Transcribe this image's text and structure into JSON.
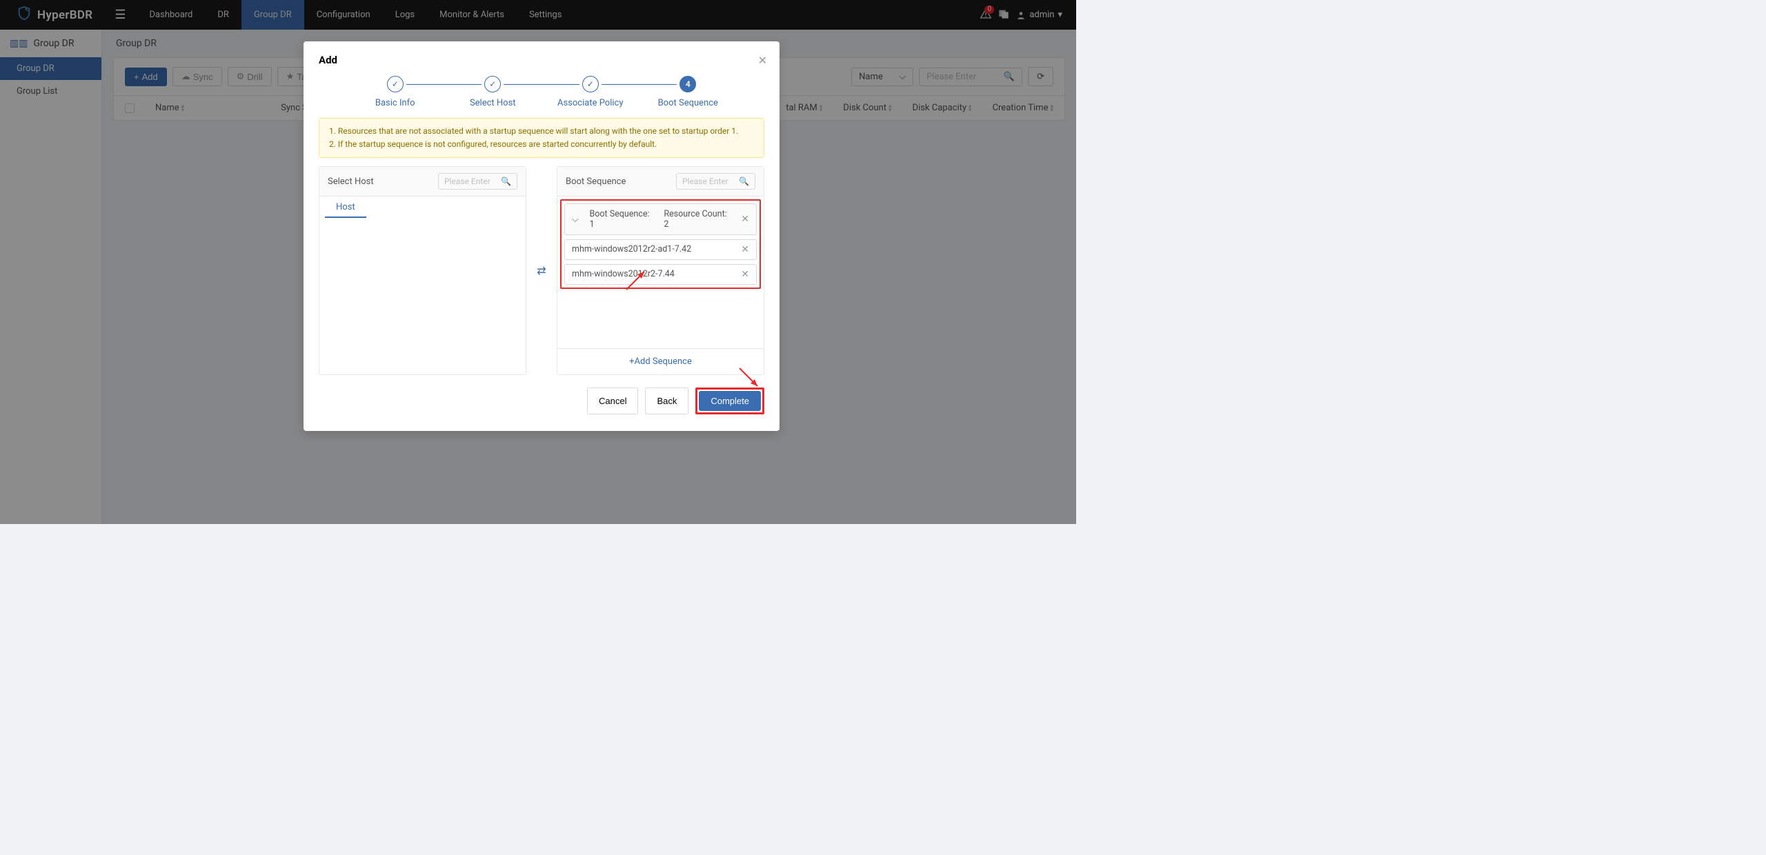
{
  "brand": "HyperBDR",
  "nav": [
    "Dashboard",
    "DR",
    "Group DR",
    "Configuration",
    "Logs",
    "Monitor & Alerts",
    "Settings"
  ],
  "nav_active_index": 2,
  "alert_badge": "0",
  "user": "admin",
  "sidebar_title": "Group DR",
  "sidebar_items": [
    "Group DR",
    "Group List"
  ],
  "sidebar_active_index": 0,
  "breadcrumb": "Group DR",
  "toolbar": {
    "add": "Add",
    "sync": "Sync",
    "drill": "Drill",
    "takeover": "Takeover",
    "search_by": "Name",
    "placeholder": "Please Enter"
  },
  "table_cols": [
    "Name",
    "Sync Status",
    "tal RAM",
    "Disk Count",
    "Disk Capacity",
    "Creation Time"
  ],
  "modal": {
    "title": "Add",
    "steps": [
      "Basic Info",
      "Select Host",
      "Associate Policy",
      "Boot Sequence"
    ],
    "active_step": 4,
    "tip1": "1. Resources that are not associated with a startup sequence will start along with the one set to startup order 1.",
    "tip2": "2. If the startup sequence is not configured, resources are started concurrently by default.",
    "left_title": "Select Host",
    "left_tab": "Host",
    "right_title": "Boot Sequence",
    "search_ph": "Please Enter",
    "seq_label": "Boot Sequence: 1",
    "seq_count": "Resource Count: 2",
    "seq_items": [
      "mhm-windows2012r2-ad1-7.42",
      "mhm-windows2012r2-7.44"
    ],
    "add_seq": "Add Sequence",
    "cancel": "Cancel",
    "back": "Back",
    "complete": "Complete"
  }
}
